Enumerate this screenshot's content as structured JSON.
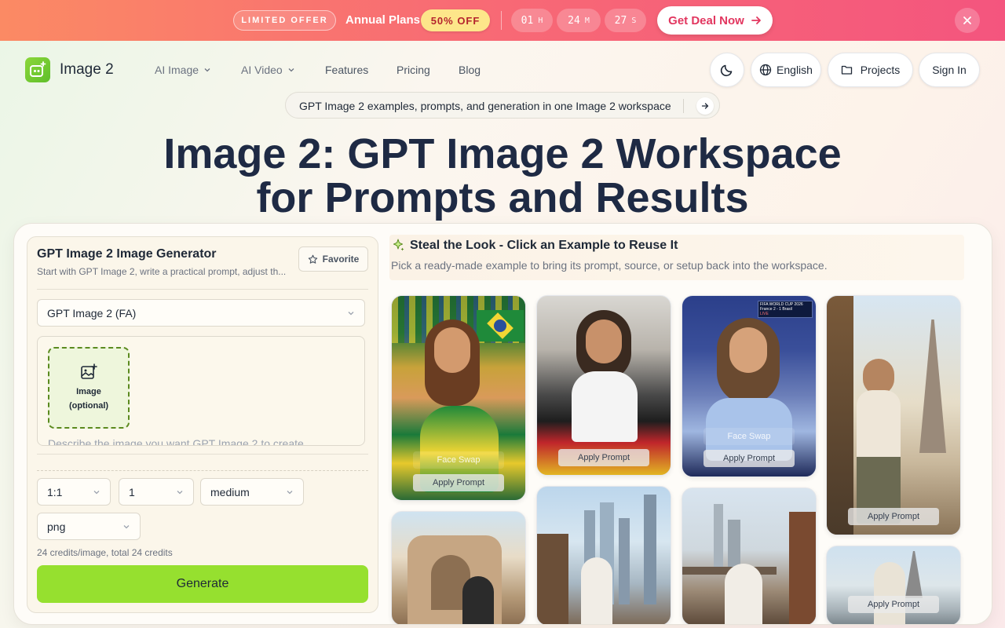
{
  "banner": {
    "limited": "LIMITED OFFER",
    "annual": "Annual Plans",
    "off": "50% OFF",
    "timer": [
      {
        "value": "01",
        "unit": "H"
      },
      {
        "value": "24",
        "unit": "M"
      },
      {
        "value": "27",
        "unit": "S"
      }
    ],
    "deal": "Get Deal Now",
    "close_icon": "close-icon"
  },
  "nav": {
    "brand": "Image 2",
    "items": [
      "AI Image",
      "AI Video",
      "Features",
      "Pricing",
      "Blog"
    ],
    "language": "English",
    "projects": "Projects",
    "sign_in": "Sign In",
    "theme_icon": "moon-icon"
  },
  "announcement": {
    "text": "GPT Image 2 examples, prompts, and generation in one Image 2 workspace"
  },
  "hero": {
    "line1": "Image 2: GPT Image 2 Workspace",
    "line2": "for Prompts and Results"
  },
  "generator": {
    "title": "GPT Image 2 Image Generator",
    "subtitle": "Start with GPT Image 2, write a practical prompt, adjust th...",
    "favorite": "Favorite",
    "model": "GPT Image 2 (FA)",
    "upload_line1": "Image",
    "upload_line2": "(optional)",
    "prompt_placeholder": "Describe the image you want GPT Image 2 to create",
    "aspect": "1:1",
    "count": "1",
    "quality": "medium",
    "format": "png",
    "credits": "24 credits/image, total 24 credits",
    "generate": "Generate"
  },
  "examples": {
    "title": "Steal the Look - Click an Example to Reuse It",
    "subtitle": "Pick a ready-made example to bring its prompt, source, or setup back into the workspace.",
    "apply": "Apply Prompt",
    "swap": "Face Swap",
    "card_labels": {
      "c1_score": "FIFA WORLD CUP 2026",
      "c1_score_line": "France 2 - 1 Brasil",
      "c1_time": "LIVE"
    }
  },
  "colors": {
    "accent": "#96e02f",
    "banner_start": "#fb8a64",
    "banner_end": "#f4557e",
    "hero_text": "#1e2a44"
  }
}
